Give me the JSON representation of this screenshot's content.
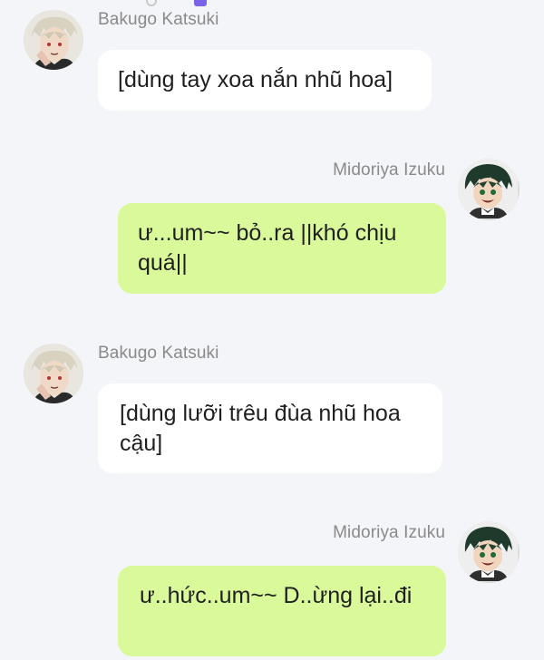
{
  "colors": {
    "background": "#f4f5f9",
    "incoming_bubble": "#ffffff",
    "outgoing_bubble": "#d9f99a",
    "name_text": "#8a8a8a"
  },
  "messages": [
    {
      "sender": "Bakugo Katsuki",
      "side": "left",
      "avatar_icon": "bakugo-avatar",
      "text": "[dùng tay xoa nắn nhũ hoa]"
    },
    {
      "sender": "Midoriya Izuku",
      "side": "right",
      "avatar_icon": "midoriya-avatar",
      "text": "ư...um~~ bỏ..ra ||khó chịu quá||"
    },
    {
      "sender": "Bakugo Katsuki",
      "side": "left",
      "avatar_icon": "bakugo-avatar",
      "text": "[dùng lưỡi trêu đùa nhũ hoa cậu]"
    },
    {
      "sender": "Midoriya Izuku",
      "side": "right",
      "avatar_icon": "midoriya-avatar",
      "text": "ư..hức..um~~ D..ừng lại..đi"
    }
  ]
}
